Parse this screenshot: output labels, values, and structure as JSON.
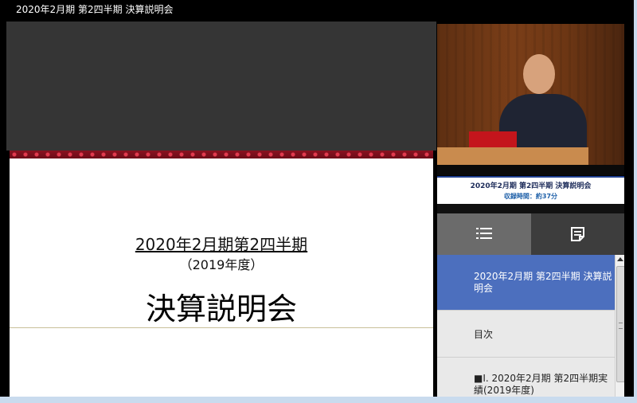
{
  "window": {
    "title": "2020年2月期 第2四半期 決算説明会"
  },
  "slide": {
    "title_line1": "2020年2月期第2四半期",
    "title_line2": "（2019年度）",
    "title_line3": "決算説明会"
  },
  "video": {
    "caption_title": "2020年2月期  第2四半期  決算説明会",
    "caption_sub": "収録時間：約37分"
  },
  "tabs": [
    {
      "name": "chapters",
      "icon": "list-icon"
    },
    {
      "name": "notes",
      "icon": "notes-icon"
    }
  ],
  "chapters": [
    {
      "label": "2020年2月期 第2四半期 決算説明会",
      "selected": true
    },
    {
      "label": "目次",
      "selected": false
    },
    {
      "label": "■I. 2020年2月期 第2四半期実績(2019年度)",
      "selected": false
    }
  ],
  "colors": {
    "selected": "#4c6fbe",
    "caption_border": "#1f3f8f"
  }
}
